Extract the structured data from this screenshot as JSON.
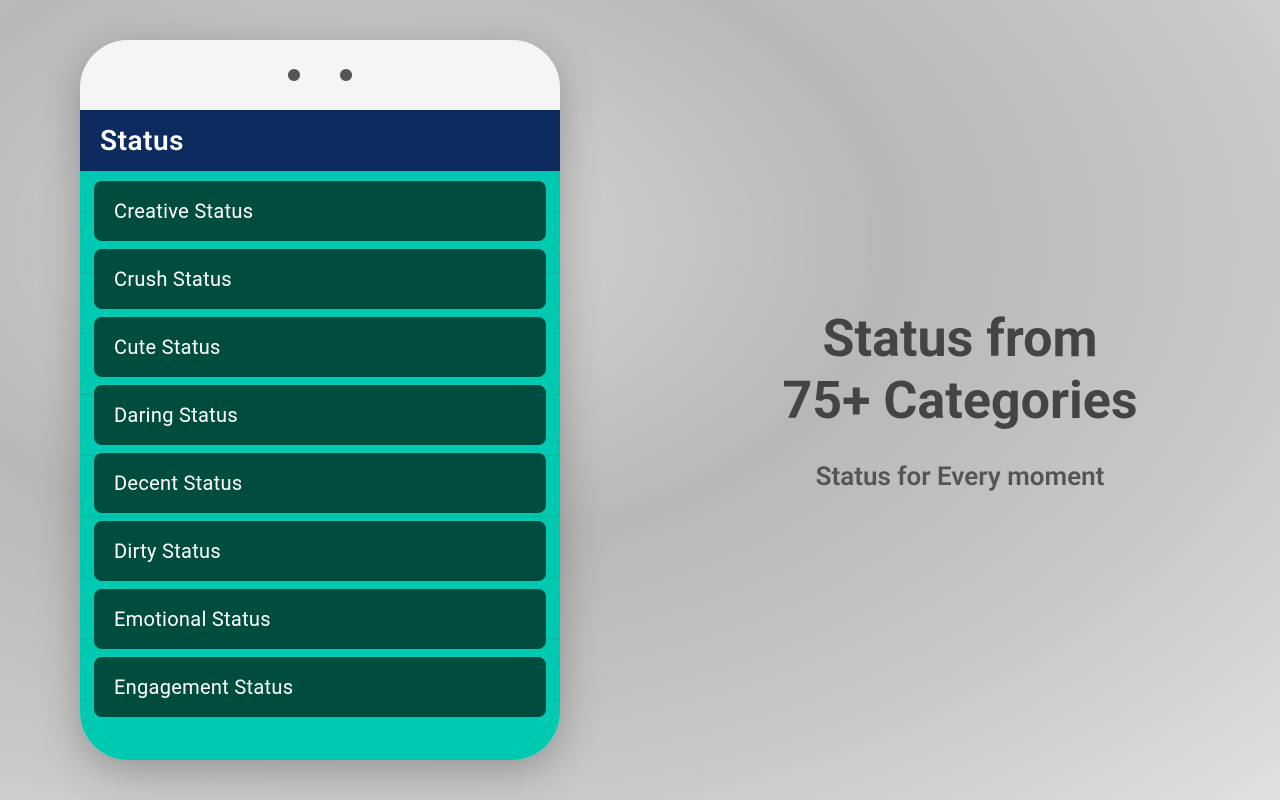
{
  "app": {
    "title": "Status"
  },
  "menu": {
    "items": [
      {
        "label": "Creative Status"
      },
      {
        "label": "Crush Status"
      },
      {
        "label": "Cute Status"
      },
      {
        "label": "Daring Status"
      },
      {
        "label": "Decent Status"
      },
      {
        "label": "Dirty Status"
      },
      {
        "label": "Emotional Status"
      },
      {
        "label": "Engagement Status"
      }
    ]
  },
  "promo": {
    "tagline_main": "Status from\n75+ Categories",
    "tagline_sub": "Status for Every moment"
  },
  "colors": {
    "header_bg": "#0d2b5e",
    "screen_bg": "#00c9b1",
    "item_bg": "#004d40"
  }
}
